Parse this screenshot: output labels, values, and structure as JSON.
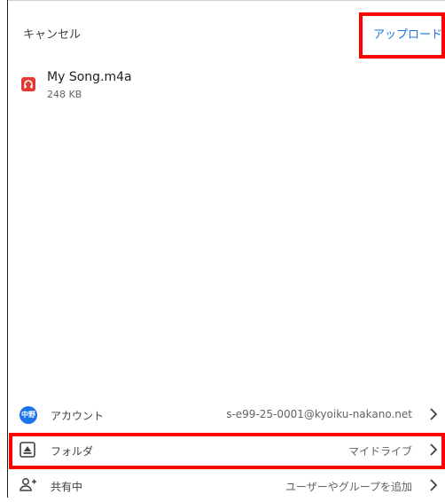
{
  "header": {
    "cancel_label": "キャンセル",
    "upload_label": "アップロード"
  },
  "file": {
    "name": "My Song.m4a",
    "size": "248 KB",
    "icon": "audio-file-icon"
  },
  "settings": {
    "account": {
      "label": "アカウント",
      "value": "s-e99-25-0001@kyoiku-nakano.net",
      "avatar_text": "中野"
    },
    "folder": {
      "label": "フォルダ",
      "value": "マイドライブ"
    },
    "sharing": {
      "label": "共有中",
      "value": "ユーザーやグループを追加"
    }
  },
  "colors": {
    "accent": "#1a73e8",
    "highlight": "#ff0000",
    "file_icon": "#e53935"
  }
}
